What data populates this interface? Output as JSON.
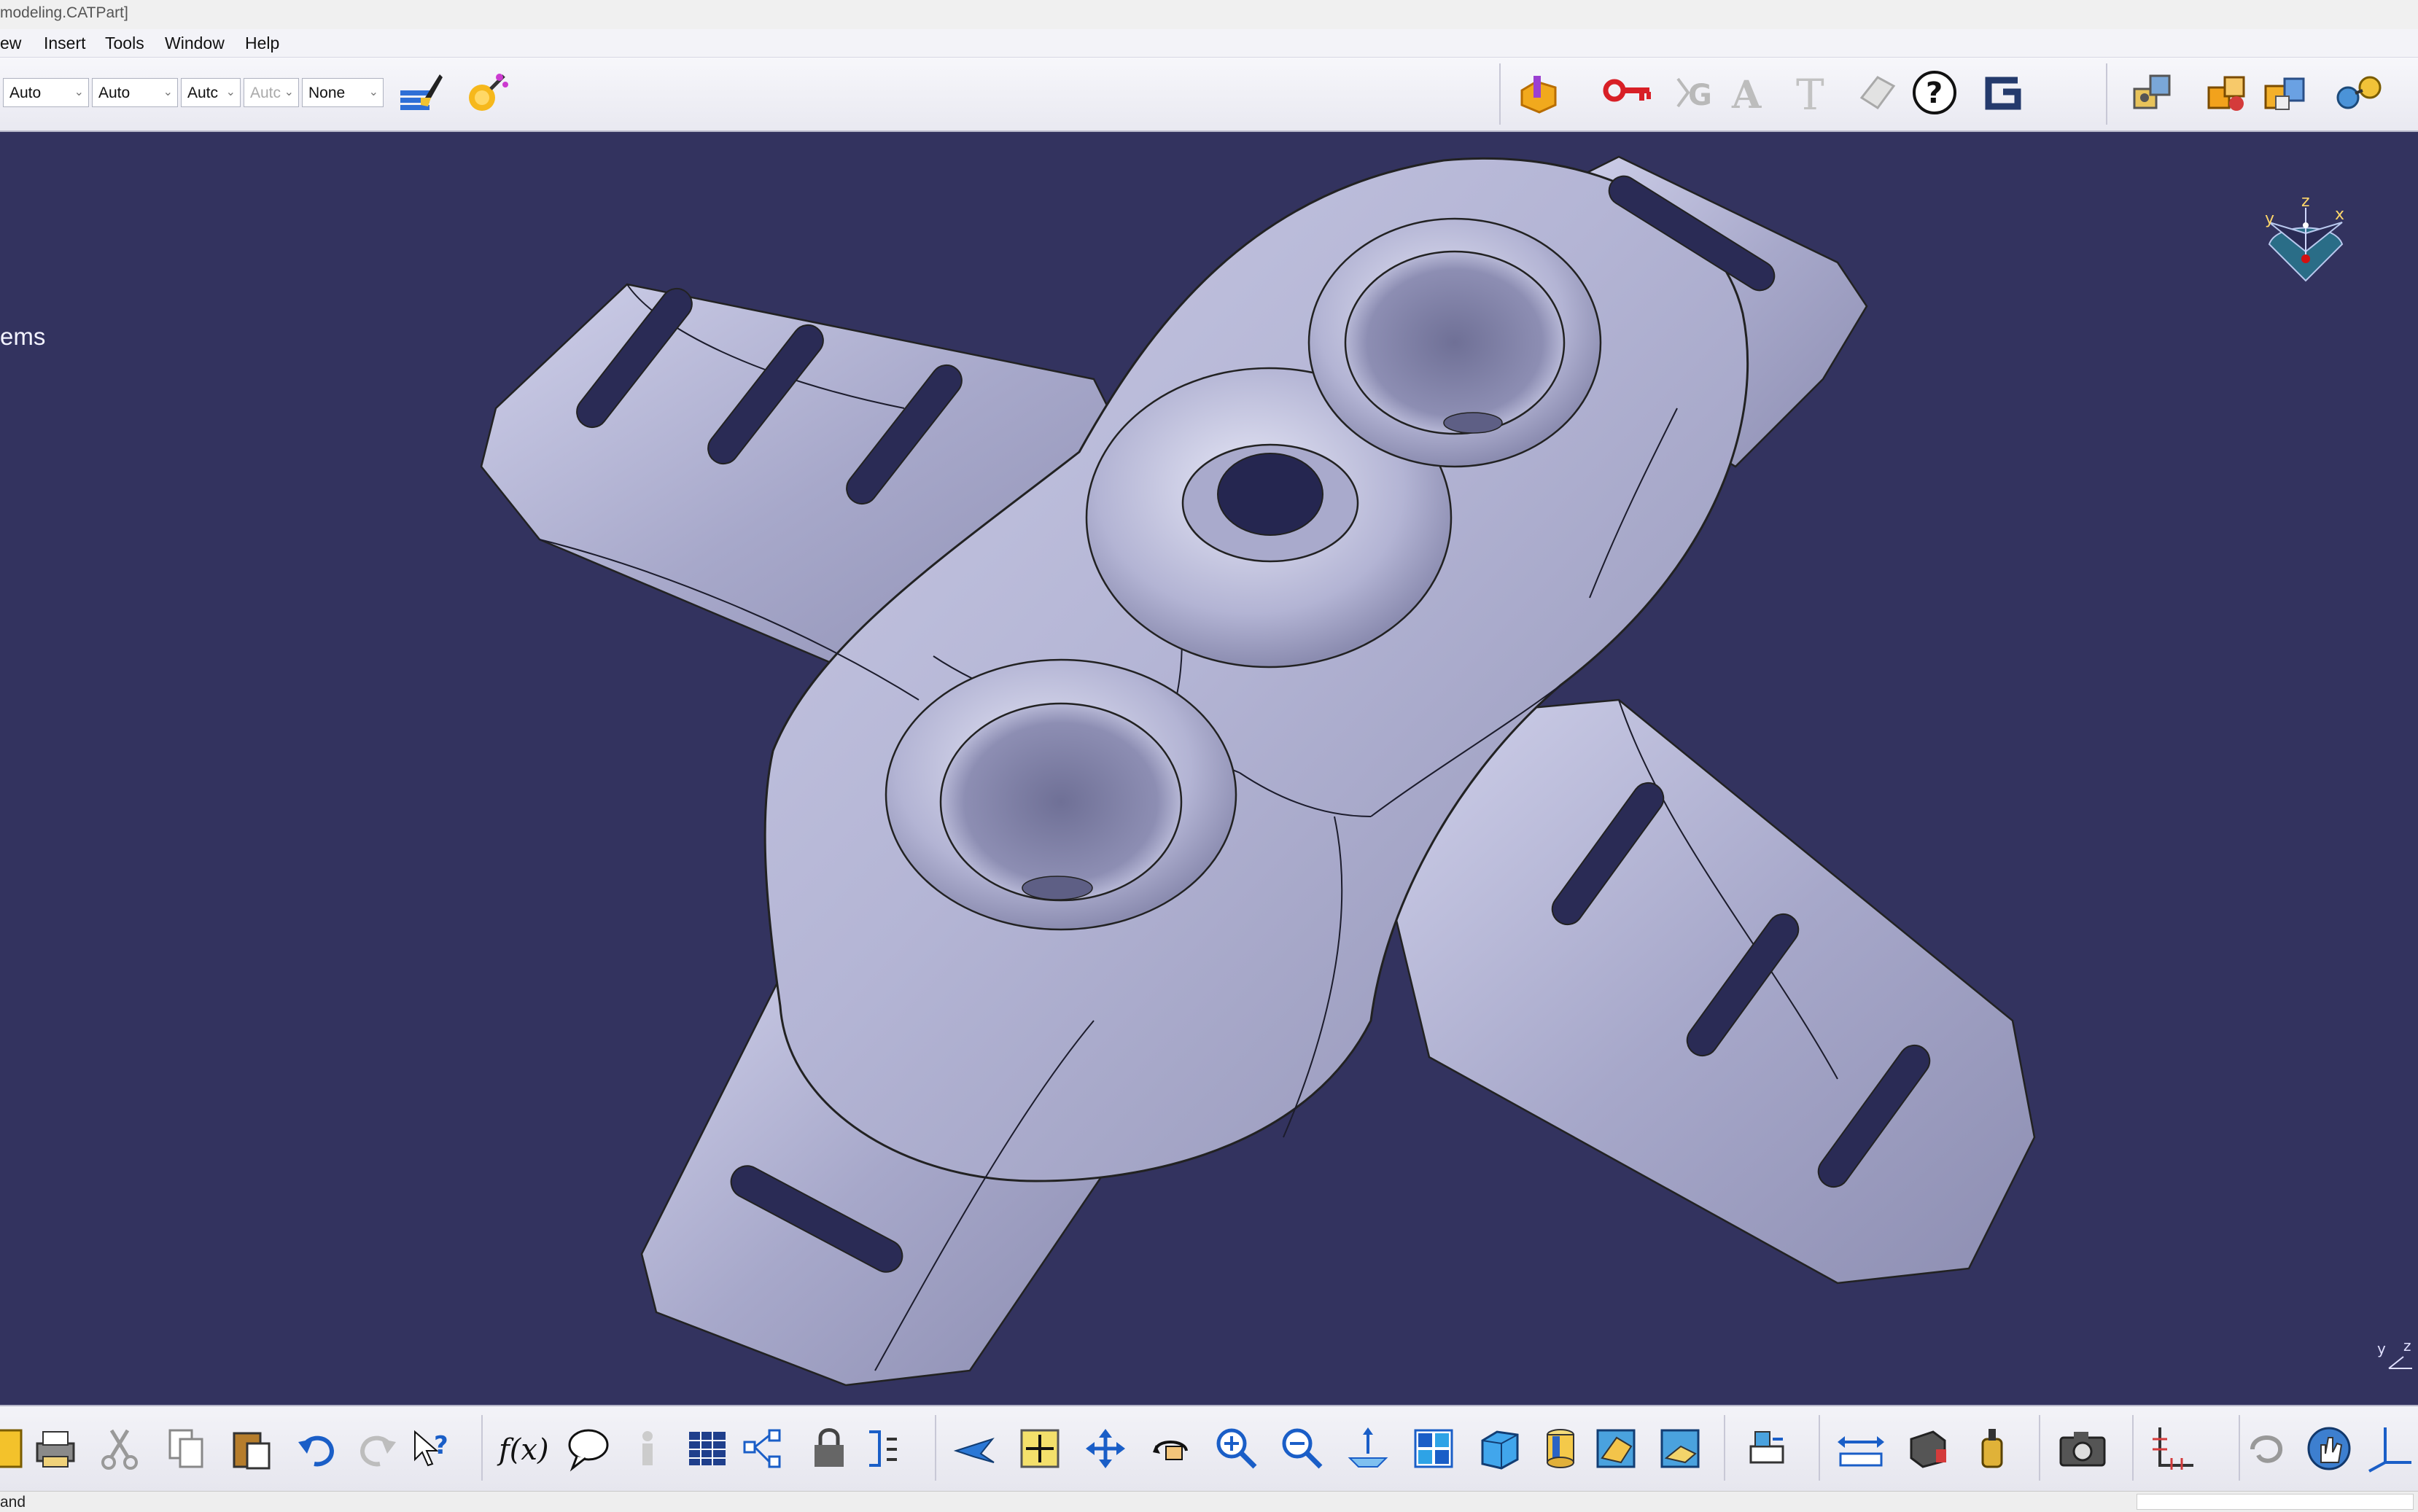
{
  "window": {
    "title": "modeling.CATPart]"
  },
  "menu": {
    "items": [
      "ew",
      "Insert",
      "Tools",
      "Window",
      "Help"
    ]
  },
  "graphic_props": {
    "fill_value": "Auto",
    "line_value": "Auto",
    "weight_value": "Autc",
    "layer_value": "Autc",
    "linetype_value": "None"
  },
  "viewport": {
    "background": "#33335f",
    "left_label": "ems",
    "compass_axes": {
      "x": "x",
      "y": "y",
      "z": "z"
    },
    "corner_axes": {
      "y": "y",
      "z": "z"
    }
  },
  "top_toolbar_icons": [
    "painter-icon",
    "magic-wand-icon",
    "catalog-icon",
    "key-icon",
    "grayed-g-icon",
    "grayed-a-icon",
    "text-icon",
    "flag-note-icon",
    "help-icon",
    "brand-g-icon",
    "assembly-icon",
    "multi-part-icon",
    "components-icon",
    "link-icon"
  ],
  "bottom_toolbar_icons": [
    "save-icon",
    "print-icon",
    "cut-icon",
    "copy-icon",
    "paste-icon",
    "undo-icon",
    "redo-icon",
    "whats-this-icon",
    "formula-icon",
    "comment-icon",
    "knowledge-icon",
    "table-icon",
    "tree-icon",
    "lock-icon",
    "parameters-icon",
    "fly-mode-icon",
    "fit-all-icon",
    "pan-icon",
    "rotate-icon",
    "zoom-in-icon",
    "zoom-out-icon",
    "normal-view-icon",
    "multi-view-icon",
    "iso-view-icon",
    "shading-icon",
    "material-icon",
    "hide-show-icon",
    "swap-visible-icon",
    "measure-between-icon",
    "measure-item-icon",
    "measure-inertia-icon",
    "capture-icon",
    "axis-system-icon",
    "refresh-icon",
    "hand-icon",
    "compass-icon"
  ],
  "status": {
    "text": "and"
  }
}
